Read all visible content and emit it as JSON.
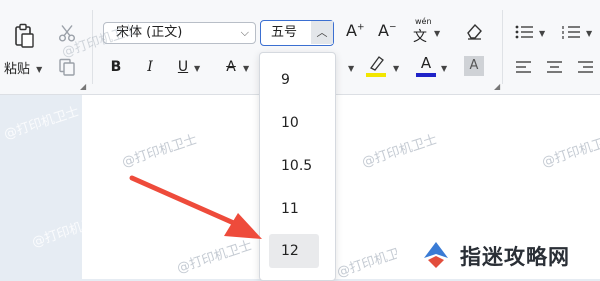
{
  "toolbar": {
    "paste_label": "粘贴",
    "font_name": "宋体 (正文)",
    "font_size": "五号",
    "grow_label": "A",
    "shrink_label": "A",
    "phonetic_label": "wén",
    "bold": "B",
    "italic": "I",
    "underline": "U",
    "strike": "A",
    "highlight_letter": "A",
    "font_color_letter": "A",
    "shade_letter": "A"
  },
  "colors": {
    "highlight": "#f2e600",
    "font_color": "#1f23c8",
    "annotation_arrow": "#ee4b3b",
    "logo_blue": "#3a7bd5"
  },
  "font_size_menu": {
    "options": [
      "9",
      "10",
      "10.5",
      "11",
      "12"
    ],
    "selected": "12"
  },
  "watermark_text": "@打印机卫士",
  "logo_text": "指迷攻略网"
}
